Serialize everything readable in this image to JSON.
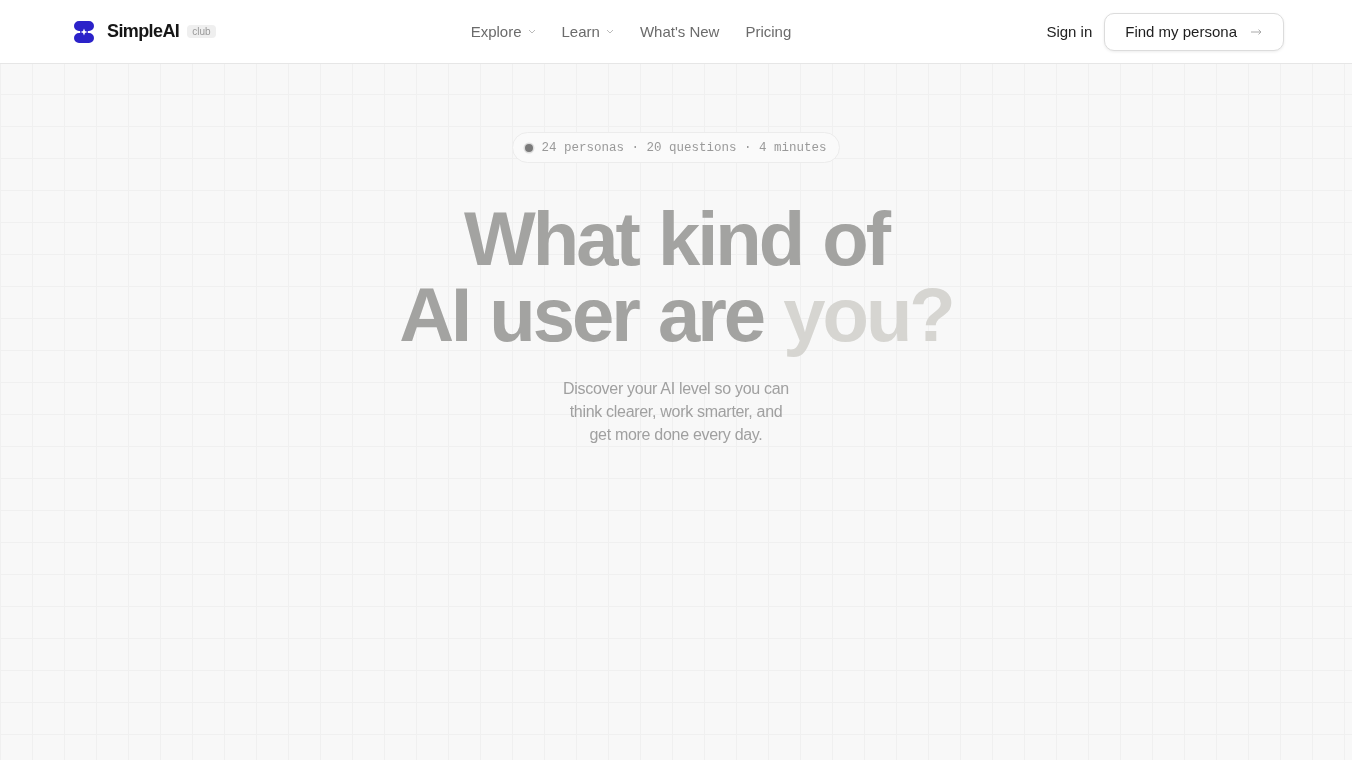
{
  "header": {
    "logo": {
      "name": "SimpleAI",
      "tag": "club"
    },
    "nav": [
      {
        "label": "Explore",
        "dropdown": true
      },
      {
        "label": "Learn",
        "dropdown": true
      },
      {
        "label": "What's New",
        "dropdown": false
      },
      {
        "label": "Pricing",
        "dropdown": false
      }
    ],
    "sign_in": "Sign in",
    "cta": "Find my persona"
  },
  "hero": {
    "badge": "24 personas · 20 questions · 4 minutes",
    "headline": [
      [
        {
          "text": "What kind of",
          "faded": false
        }
      ],
      [
        {
          "text": "AI user are",
          "faded": false
        },
        {
          "text": "you?",
          "faded": true
        }
      ]
    ],
    "subtitle": "Discover your AI level so you can think clearer, work smarter, and get more done every day."
  }
}
